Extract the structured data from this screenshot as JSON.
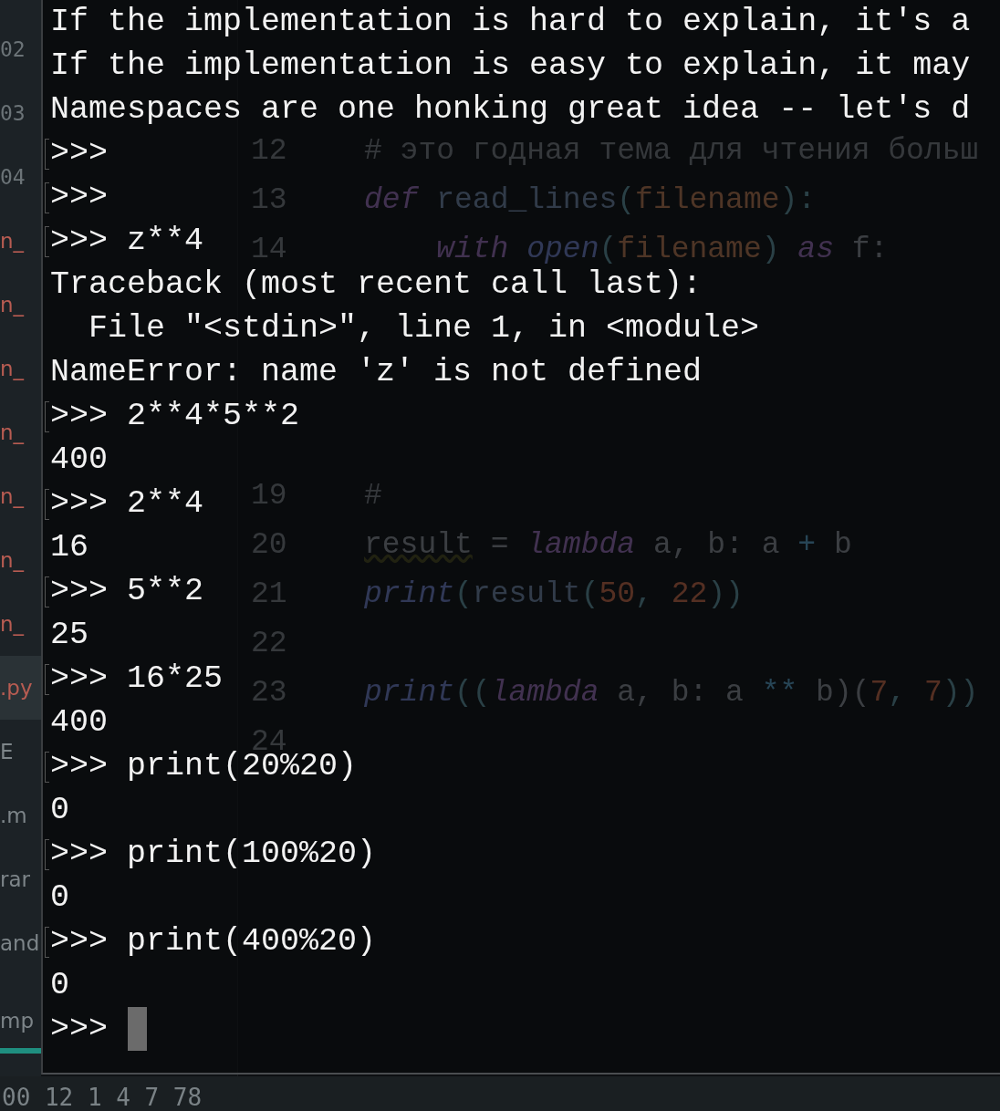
{
  "sidebar": {
    "items": [
      {
        "text": "02",
        "kind": "line_number"
      },
      {
        "text": "03",
        "kind": "line_number"
      },
      {
        "text": "04",
        "kind": "line_number"
      },
      {
        "text": "n_",
        "kind": "file",
        "selected": false
      },
      {
        "text": "n_",
        "kind": "file",
        "selected": false
      },
      {
        "text": "n_",
        "kind": "file",
        "selected": false
      },
      {
        "text": "n_",
        "kind": "file",
        "selected": false
      },
      {
        "text": "n_",
        "kind": "file",
        "selected": false
      },
      {
        "text": "n_",
        "kind": "file",
        "selected": false
      },
      {
        "text": "n_",
        "kind": "file",
        "selected": false
      },
      {
        "text": ".py",
        "kind": "file",
        "selected": true
      },
      {
        "text": "E",
        "kind": "label"
      },
      {
        "text": ".m",
        "kind": "label"
      },
      {
        "text": "rar",
        "kind": "label"
      },
      {
        "text": "and",
        "kind": "label"
      },
      {
        "text": "mp",
        "kind": "tab",
        "selected": true
      }
    ]
  },
  "editor": {
    "blocks": [
      {
        "lines": [
          {
            "number": "12",
            "tokens": [
              {
                "text": "# это годная тема для чтения больш",
                "kind": "comment"
              }
            ]
          },
          {
            "number": "13",
            "tokens": [
              {
                "text": "def",
                "kind": "keyword"
              },
              {
                "text": " read_lines",
                "kind": "function"
              },
              {
                "text": "(",
                "kind": "punct"
              },
              {
                "text": "filename",
                "kind": "param"
              },
              {
                "text": "):",
                "kind": "punct"
              }
            ]
          },
          {
            "number": "14",
            "tokens": [
              {
                "text": "    with",
                "kind": "keyword"
              },
              {
                "text": " open",
                "kind": "builtin"
              },
              {
                "text": "(",
                "kind": "punct"
              },
              {
                "text": "filename",
                "kind": "param"
              },
              {
                "text": ")",
                "kind": "punct"
              },
              {
                "text": " as",
                "kind": "keyword"
              },
              {
                "text": " f:",
                "kind": "plain"
              }
            ]
          }
        ]
      },
      {
        "lines": [
          {
            "number": "19",
            "tokens": [
              {
                "text": "#",
                "kind": "comment"
              }
            ]
          },
          {
            "number": "20",
            "tokens": [
              {
                "text": "result",
                "kind": "warning"
              },
              {
                "text": " = ",
                "kind": "plain"
              },
              {
                "text": "lambda",
                "kind": "keyword"
              },
              {
                "text": " a, b: a ",
                "kind": "plain"
              },
              {
                "text": "+",
                "kind": "operator"
              },
              {
                "text": " b",
                "kind": "plain"
              }
            ]
          },
          {
            "number": "21",
            "tokens": [
              {
                "text": "print",
                "kind": "builtin"
              },
              {
                "text": "(",
                "kind": "punct"
              },
              {
                "text": "result",
                "kind": "function"
              },
              {
                "text": "(",
                "kind": "punct"
              },
              {
                "text": "50",
                "kind": "number"
              },
              {
                "text": ", ",
                "kind": "punct"
              },
              {
                "text": "22",
                "kind": "number"
              },
              {
                "text": "))",
                "kind": "punct"
              }
            ]
          },
          {
            "number": "22"
          },
          {
            "number": "23",
            "tokens": [
              {
                "text": "print",
                "kind": "builtin"
              },
              {
                "text": "((",
                "kind": "punct"
              },
              {
                "text": "lambda",
                "kind": "keyword"
              },
              {
                "text": " a, b: a ",
                "kind": "plain"
              },
              {
                "text": "**",
                "kind": "operator"
              },
              {
                "text": " b)(",
                "kind": "plain"
              },
              {
                "text": "7",
                "kind": "number"
              },
              {
                "text": ", ",
                "kind": "punct"
              },
              {
                "text": "7",
                "kind": "number"
              },
              {
                "text": "))",
                "kind": "punct"
              }
            ]
          },
          {
            "number": "24"
          }
        ]
      }
    ]
  },
  "terminal": {
    "lines": [
      {
        "kind": "output",
        "text": "If the implementation is hard to explain, it's a"
      },
      {
        "kind": "output",
        "text": "If the implementation is easy to explain, it may"
      },
      {
        "kind": "output",
        "text": "Namespaces are one honking great idea -- let's d"
      },
      {
        "kind": "prompt",
        "prompt": ">>>",
        "marked": true
      },
      {
        "kind": "prompt",
        "prompt": ">>>",
        "marked": true
      },
      {
        "kind": "prompt",
        "prompt": ">>>",
        "input": "z**4",
        "marked": true
      },
      {
        "kind": "output",
        "text": "Traceback (most recent call last):"
      },
      {
        "kind": "output",
        "text": "  File \"<stdin>\", line 1, in <module>"
      },
      {
        "kind": "output",
        "text": "NameError: name 'z' is not defined"
      },
      {
        "kind": "prompt",
        "prompt": ">>>",
        "input": "2**4*5**2",
        "marked": true
      },
      {
        "kind": "output",
        "text": "400"
      },
      {
        "kind": "prompt",
        "prompt": ">>>",
        "input": "2**4",
        "marked": true
      },
      {
        "kind": "output",
        "text": "16"
      },
      {
        "kind": "prompt",
        "prompt": ">>>",
        "input": "5**2",
        "marked": true
      },
      {
        "kind": "output",
        "text": "25"
      },
      {
        "kind": "prompt",
        "prompt": ">>>",
        "input": "16*25",
        "marked": true
      },
      {
        "kind": "output",
        "text": "400"
      },
      {
        "kind": "prompt",
        "prompt": ">>>",
        "input": "print(20%20)",
        "marked": true
      },
      {
        "kind": "output",
        "text": "0"
      },
      {
        "kind": "prompt",
        "prompt": ">>>",
        "input": "print(100%20)",
        "marked": true
      },
      {
        "kind": "output",
        "text": "0"
      },
      {
        "kind": "prompt",
        "prompt": ">>>",
        "input": "print(400%20)",
        "marked": true
      },
      {
        "kind": "output",
        "text": "0"
      },
      {
        "kind": "prompt",
        "prompt": ">>>",
        "marked": false,
        "cursor": true
      }
    ]
  },
  "status_bar": {
    "text": "00 12 1 4 7 78"
  }
}
